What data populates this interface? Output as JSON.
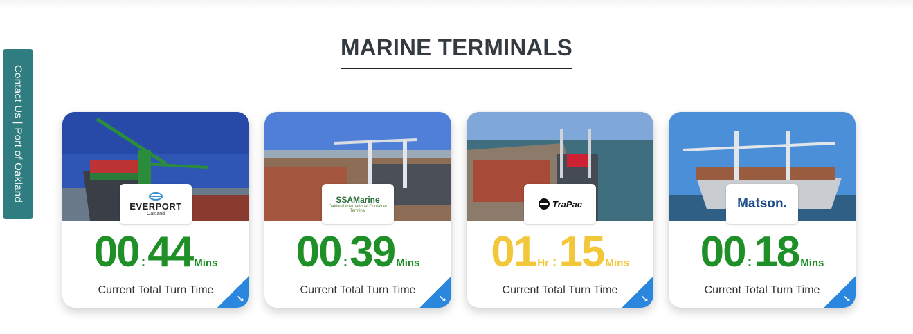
{
  "side_tab": {
    "label": "Contact Us | Port of Oakland"
  },
  "title": "MARINE TERMINALS",
  "colors": {
    "green": "#1f8f28",
    "yellow": "#f2c83a",
    "accent": "#2b86dd",
    "tab": "#2f7d80"
  },
  "cards": [
    {
      "terminal": "Everport",
      "logo_text": "EVERPORT",
      "logo_sub": "Oakland",
      "hours": null,
      "minutes": "44",
      "prefix": "00",
      "unit": "Mins",
      "caption": "Current Total Turn Time",
      "color": "green",
      "arrow_icon": "arrow-down-right-icon"
    },
    {
      "terminal": "SSA Marine",
      "logo_text": "SSAMarine",
      "logo_sub": "Oakland International Container Terminal",
      "prefix": "00",
      "minutes": "39",
      "unit": "Mins",
      "caption": "Current Total Turn Time",
      "color": "green",
      "arrow_icon": "arrow-down-right-icon"
    },
    {
      "terminal": "TraPac",
      "logo_text": "TraPac",
      "prefix": "01",
      "hr_label": "Hr",
      "minutes": "15",
      "unit": "Mins",
      "caption": "Current Total Turn Time",
      "color": "yellow",
      "arrow_icon": "arrow-down-right-icon"
    },
    {
      "terminal": "Matson",
      "logo_text": "Matson.",
      "prefix": "00",
      "minutes": "18",
      "unit": "Mins",
      "caption": "Current Total Turn Time",
      "color": "green",
      "arrow_icon": "arrow-down-right-icon"
    }
  ]
}
